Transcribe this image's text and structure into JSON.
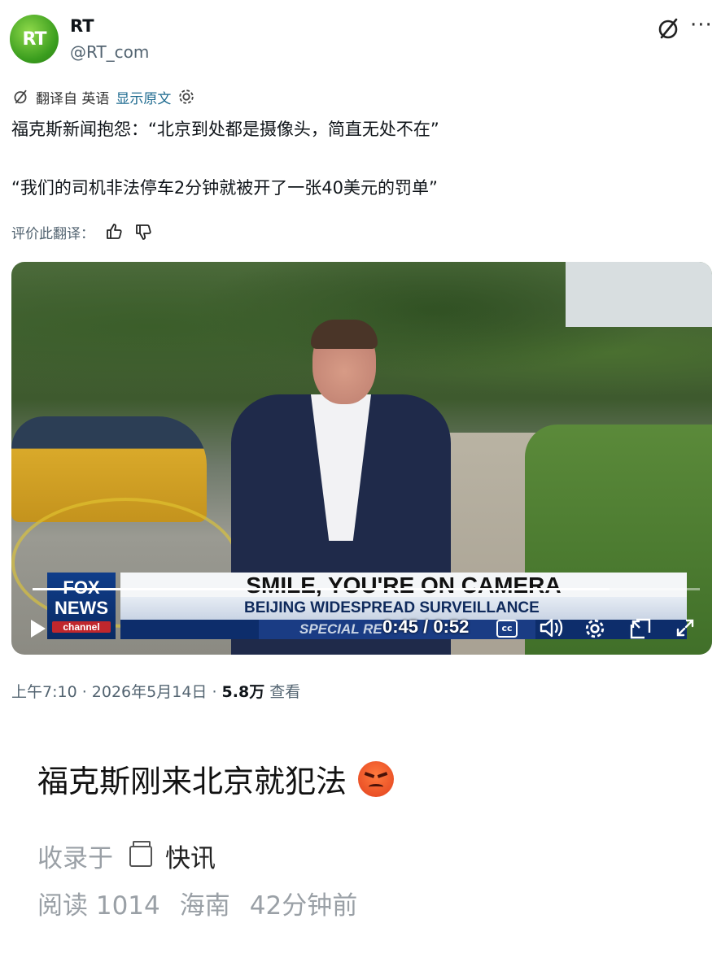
{
  "tweet": {
    "avatar_text": "RT",
    "name": "RT",
    "handle": "@RT_com",
    "more_label": "···",
    "translated_from": "翻译自 英语",
    "show_original": "显示原文",
    "line1": "福克斯新闻抱怨：“北京到处都是摄像头，简直无处不在”",
    "line2": "“我们的司机非法停车2分钟就被开了一张40美元的罚单”",
    "rate_label": "评价此翻译：",
    "meta_time": "上午7:10 · 2026年5月14日 · ",
    "meta_views": "5.8万",
    "meta_views_label": " 查看"
  },
  "video": {
    "headline": "SMILE, YOU'RE ON CAMERA",
    "subheadline": "BEIJING WIDESPREAD SURVEILLANCE",
    "special": "SPECIAL RE",
    "network_top": "FOX",
    "network_mid": "NEWS",
    "network_bottom": "channel",
    "current_time": "0:45",
    "duration": "0:52",
    "time_display": "0:45 / 0:52",
    "progress": 0.865,
    "cc_label": "cc"
  },
  "post": {
    "comment": "福克斯刚来北京就犯法",
    "emoji": "angry-face-icon",
    "collected_in": "收录于",
    "topic": "快讯",
    "reads": "阅读 1014",
    "location": "海南",
    "ago": "42分钟前"
  },
  "colors": {
    "brand_green": "#3a9d1e",
    "link": "#1d6a8f",
    "secondary_text": "#536471",
    "fox_blue": "#0f3d8a"
  }
}
